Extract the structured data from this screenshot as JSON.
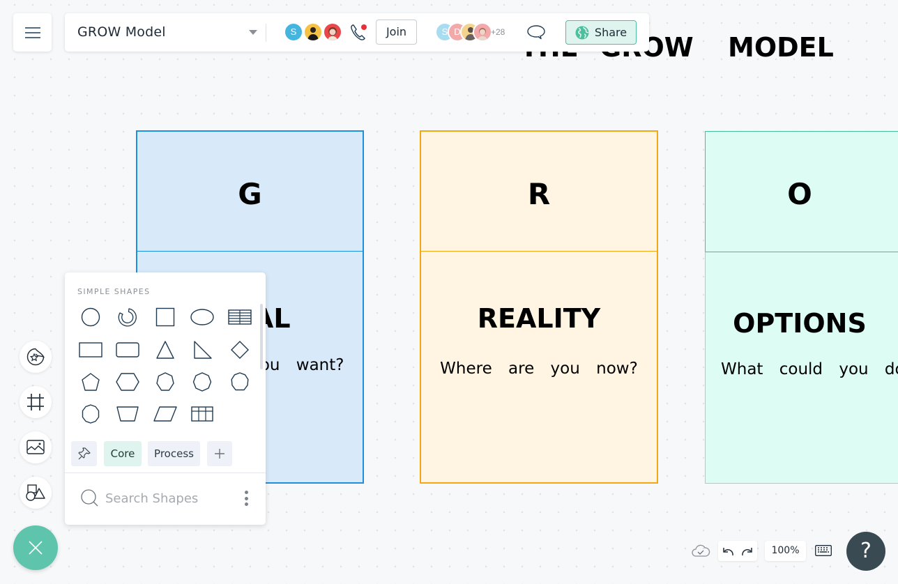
{
  "header": {
    "document_title": "GROW Model",
    "collaborators": [
      {
        "initial": "S",
        "color": "#45b5e0"
      },
      {
        "initial": "",
        "color": "#f5c244"
      },
      {
        "initial": "",
        "color": "#e8484a"
      }
    ],
    "join_label": "Join",
    "viewers": [
      {
        "initial": "S",
        "color": "#a9dcef"
      },
      {
        "initial": "D",
        "color": "#f2a9a9"
      },
      {
        "initial": "",
        "color": "#f3d38d"
      },
      {
        "initial": "",
        "color": "#f2a9a9"
      }
    ],
    "viewers_more": "+28",
    "share_label": "Share"
  },
  "board": {
    "title_words": [
      "THE",
      "GROW",
      "MODEL"
    ],
    "cards": [
      {
        "letter": "G",
        "heading": "GOAL",
        "subtitle": "What do you want?",
        "fill": "#d8eafa",
        "border": "#1e8ee0"
      },
      {
        "letter": "R",
        "heading": "REALITY",
        "subtitle": "Where are you now?",
        "fill": "#fff5e2",
        "border": "#f3a712"
      },
      {
        "letter": "O",
        "heading": "OPTIONS",
        "subtitle": "What could you do?",
        "fill": "#dcfcf4",
        "border": "#3fbf9a"
      }
    ]
  },
  "shapes_panel": {
    "section_title": "SIMPLE SHAPES",
    "shapes": [
      "circle",
      "donut",
      "square",
      "ellipse",
      "table-rows",
      "rectangle",
      "rounded-rectangle",
      "triangle",
      "right-triangle",
      "diamond",
      "pentagon",
      "hexagon",
      "heptagon",
      "octagon",
      "nonagon",
      "decagon",
      "trapezoid",
      "parallelogram",
      "table-grid"
    ],
    "tabs": [
      {
        "label": "Core",
        "active": true
      },
      {
        "label": "Process",
        "active": false
      }
    ],
    "search_placeholder": "Search Shapes"
  },
  "left_toolbar": [
    "sticker-tool",
    "frame-tool",
    "image-tool",
    "shapes-tool"
  ],
  "footer": {
    "zoom_level": "100%",
    "help_label": "?"
  },
  "colors": {
    "accent": "#5fc4ac",
    "dark": "#3a4a52"
  }
}
